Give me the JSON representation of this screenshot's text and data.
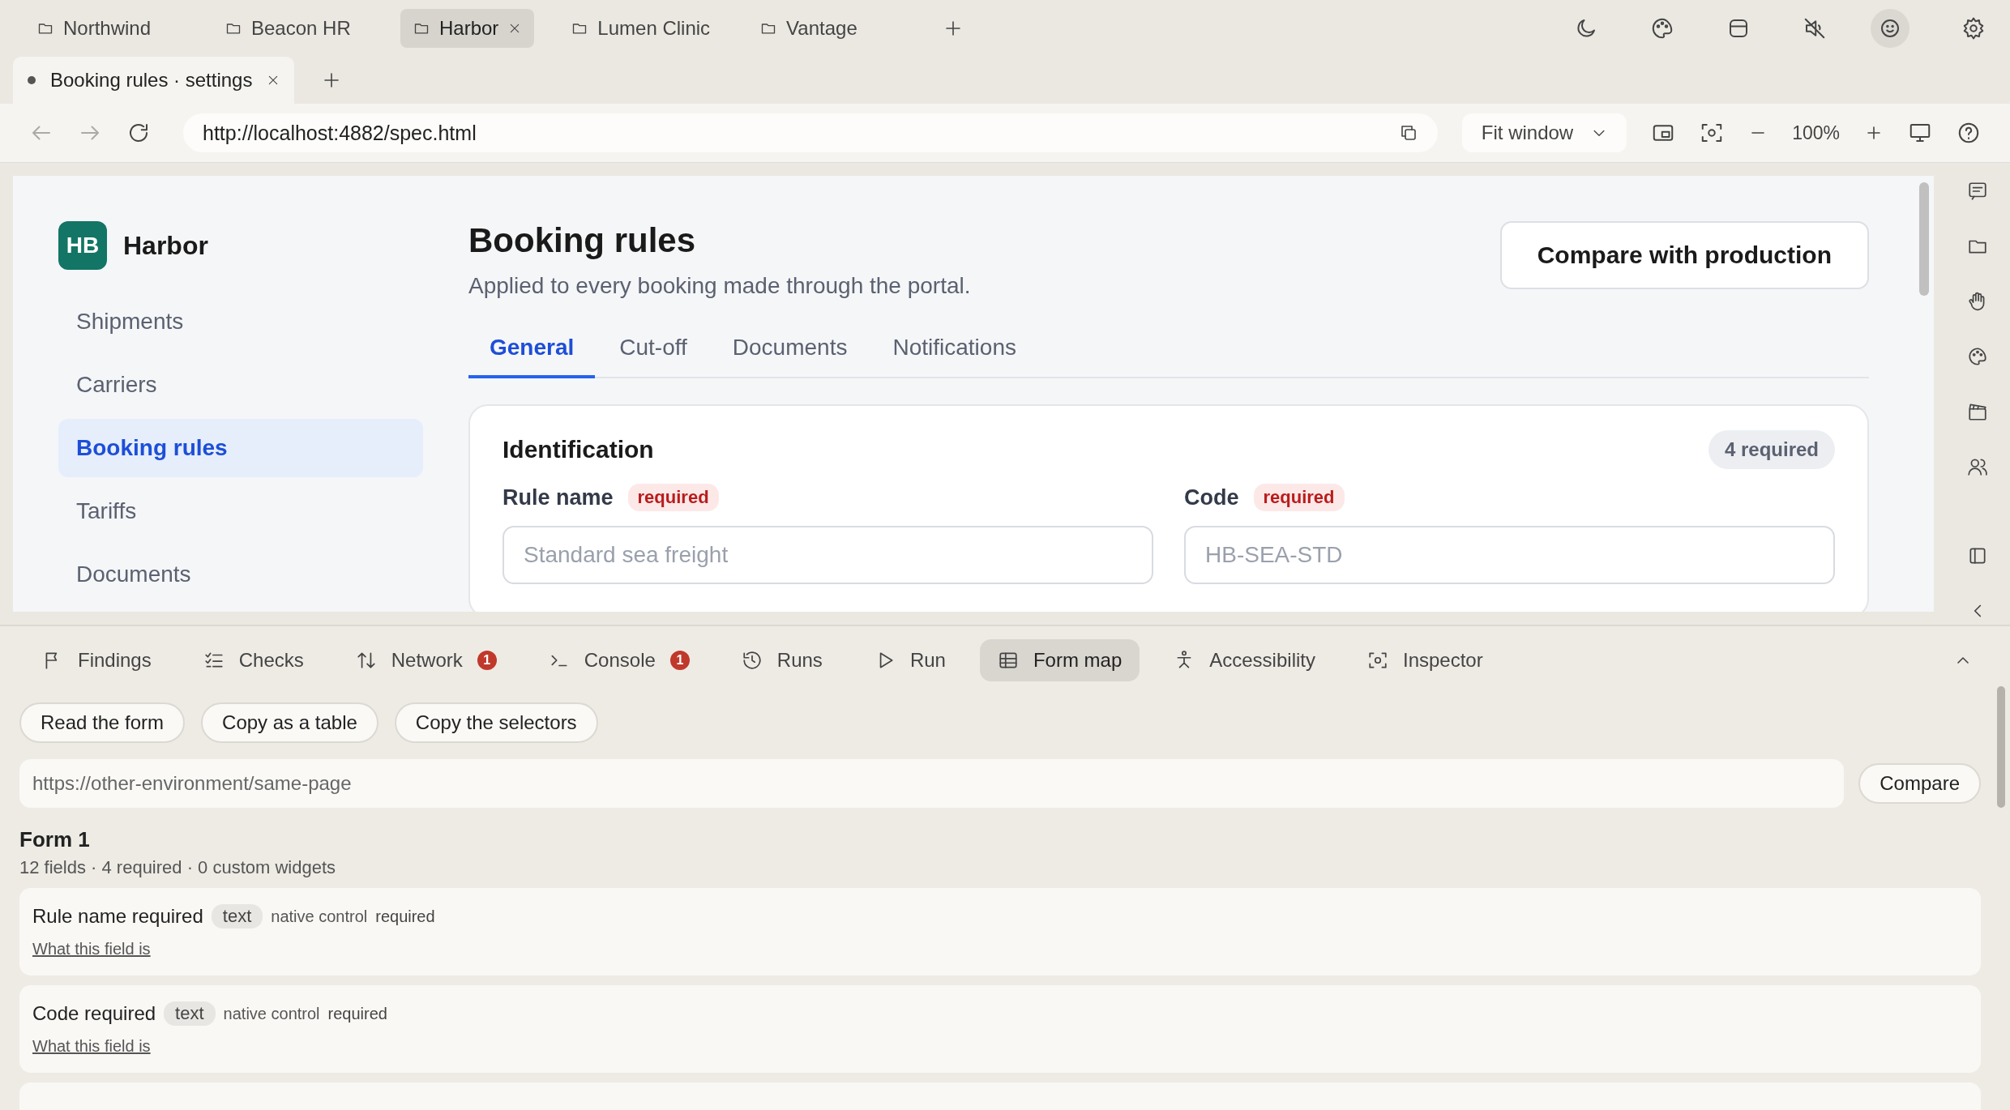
{
  "workspaces": [
    {
      "label": "Northwind",
      "selected": false
    },
    {
      "label": "Beacon HR",
      "selected": false
    },
    {
      "label": "Harbor",
      "selected": true
    },
    {
      "label": "Lumen Clinic",
      "selected": false
    },
    {
      "label": "Vantage",
      "selected": false
    }
  ],
  "page_tabs": [
    {
      "title": "Booking rules · settings",
      "selected": true
    }
  ],
  "address_bar": {
    "url": "http://localhost:4882/spec.html",
    "fit": "Fit window",
    "zoom": "100%"
  },
  "page": {
    "brand": {
      "initials": "HB",
      "name": "Harbor"
    },
    "nav": [
      {
        "label": "Shipments",
        "selected": false
      },
      {
        "label": "Carriers",
        "selected": false
      },
      {
        "label": "Booking rules",
        "selected": true
      },
      {
        "label": "Tariffs",
        "selected": false
      },
      {
        "label": "Documents",
        "selected": false
      }
    ],
    "title": "Booking rules",
    "subtitle": "Applied to every booking made through the portal.",
    "action": "Compare with production",
    "tabs": [
      {
        "label": "General",
        "selected": true
      },
      {
        "label": "Cut-off",
        "selected": false
      },
      {
        "label": "Documents",
        "selected": false
      },
      {
        "label": "Notifications",
        "selected": false
      }
    ],
    "section": {
      "title": "Identification",
      "badge": "4 required",
      "fields": [
        {
          "label": "Rule name",
          "tag": "required",
          "placeholder": "Standard sea freight"
        },
        {
          "label": "Code",
          "tag": "required",
          "placeholder": "HB-SEA-STD"
        }
      ]
    }
  },
  "devtools": {
    "tabs": [
      {
        "label": "Findings",
        "selected": false
      },
      {
        "label": "Checks",
        "selected": false
      },
      {
        "label": "Network",
        "badge": "1",
        "selected": false
      },
      {
        "label": "Console",
        "badge": "1",
        "selected": false
      },
      {
        "label": "Runs",
        "selected": false
      },
      {
        "label": "Run",
        "selected": false
      },
      {
        "label": "Form map",
        "selected": true
      },
      {
        "label": "Accessibility",
        "selected": false
      },
      {
        "label": "Inspector",
        "selected": false
      }
    ],
    "actions": [
      "Read the form",
      "Copy as a table",
      "Copy the selectors"
    ],
    "compare": {
      "placeholder": "https://other-environment/same-page",
      "button": "Compare"
    },
    "form": {
      "title": "Form 1",
      "summary": "12 fields · 4 required · 0 custom widgets",
      "fields": [
        {
          "name": "Rule name required",
          "type": "text",
          "control": "native control",
          "status": "required",
          "link": "What this field is"
        },
        {
          "name": "Code required",
          "type": "text",
          "control": "native control",
          "status": "required",
          "link": "What this field is"
        }
      ]
    }
  }
}
